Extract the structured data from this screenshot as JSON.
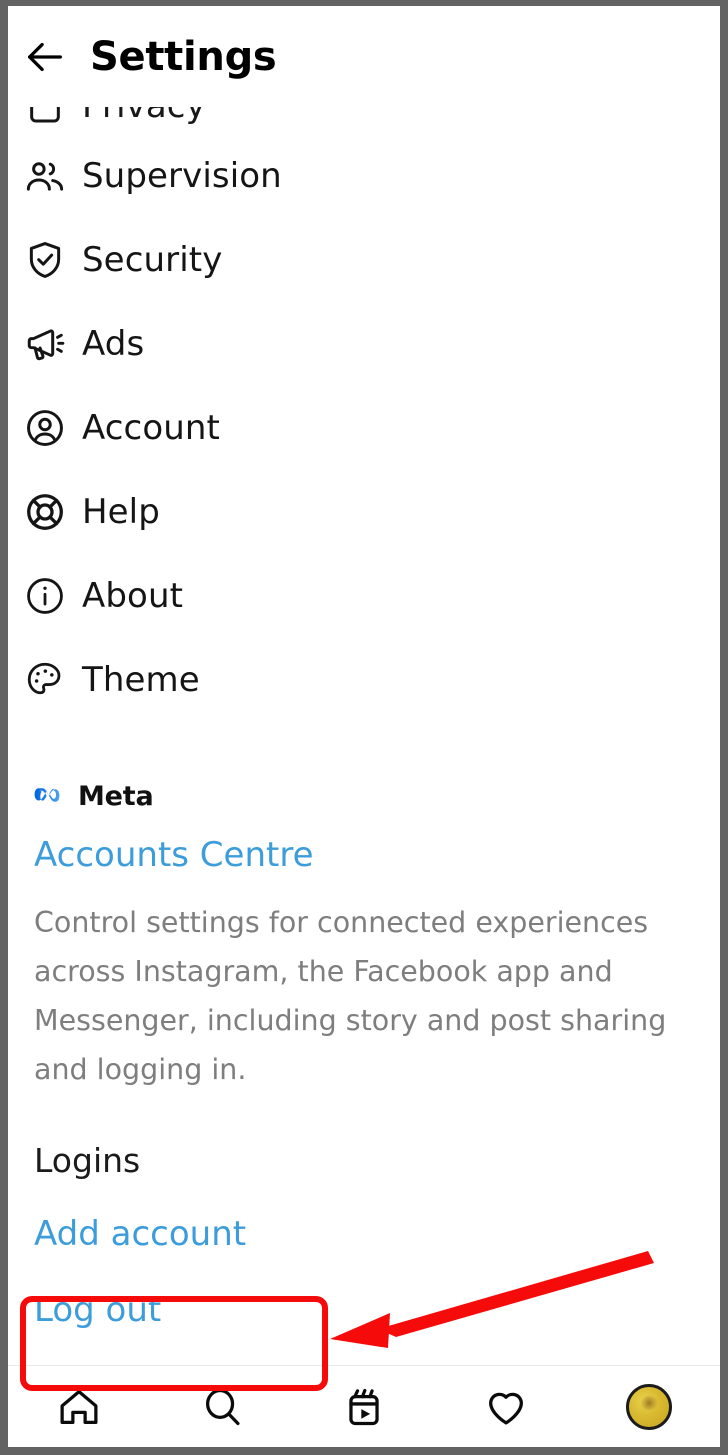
{
  "header": {
    "title": "Settings",
    "back_icon": "back-arrow-icon"
  },
  "clipped_item": {
    "label": "Privacy",
    "icon": "lock-icon"
  },
  "menu": {
    "items": [
      {
        "label": "Supervision",
        "icon": "two-people-icon"
      },
      {
        "label": "Security",
        "icon": "shield-check-icon"
      },
      {
        "label": "Ads",
        "icon": "megaphone-icon"
      },
      {
        "label": "Account",
        "icon": "account-circle-icon"
      },
      {
        "label": "Help",
        "icon": "lifebuoy-icon"
      },
      {
        "label": "About",
        "icon": "info-circle-icon"
      },
      {
        "label": "Theme",
        "icon": "palette-icon"
      }
    ]
  },
  "meta_section": {
    "brand_icon": "meta-infinity-icon",
    "brand_name": "Meta",
    "link_label": "Accounts Centre",
    "description": "Control settings for connected experiences across Instagram, the Facebook app and Messenger, including story and post sharing and logging in."
  },
  "logins_section": {
    "heading": "Logins",
    "add_account_label": "Add account",
    "logout_label": "Log out"
  },
  "annotation": {
    "color": "#f60b0b",
    "highlight_target": "Log out",
    "shapes": [
      "rounded-rectangle",
      "arrow"
    ]
  },
  "bottom_nav": {
    "items": [
      {
        "name": "home",
        "icon": "home-icon"
      },
      {
        "name": "search",
        "icon": "search-icon"
      },
      {
        "name": "reels",
        "icon": "reels-icon"
      },
      {
        "name": "likes",
        "icon": "heart-icon"
      },
      {
        "name": "profile",
        "icon": "profile-avatar"
      }
    ]
  },
  "colors": {
    "link_blue": "#3d9ddb",
    "text_black": "#151515",
    "muted_gray": "#7e7e7e",
    "annotation_red": "#f60b0b",
    "frame_gray": "#636363"
  }
}
